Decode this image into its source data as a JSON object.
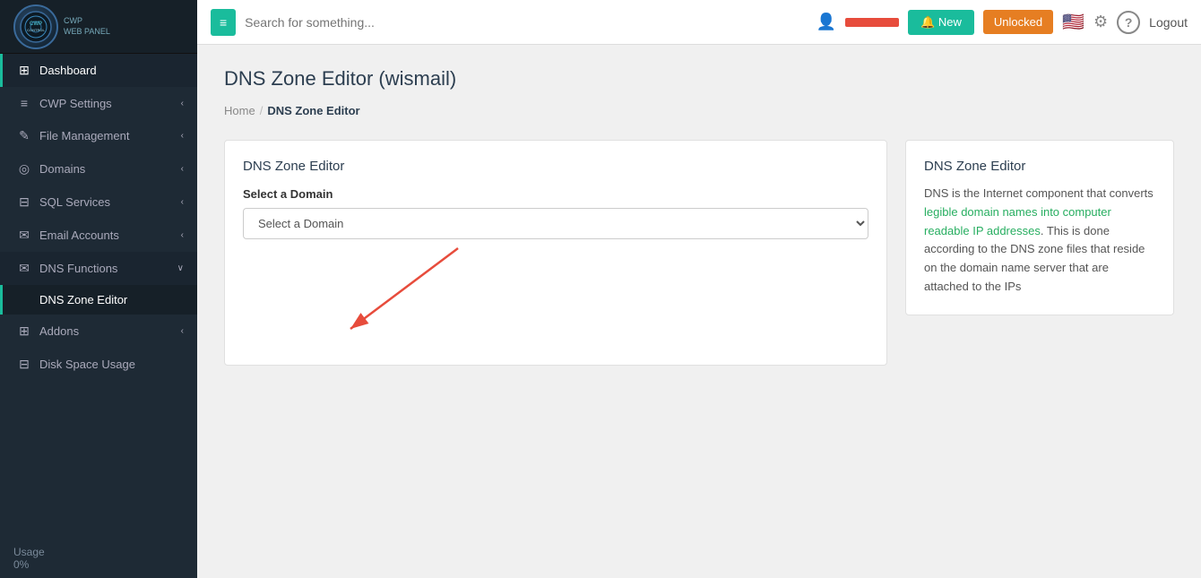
{
  "sidebar": {
    "logo": {
      "text": "CWP",
      "subtext": "CONTROL\nWEB PANEL"
    },
    "items": [
      {
        "id": "dashboard",
        "label": "Dashboard",
        "icon": "⊞",
        "active": true,
        "hasArrow": false
      },
      {
        "id": "cwp-settings",
        "label": "CWP Settings",
        "icon": "≡",
        "active": false,
        "hasArrow": true
      },
      {
        "id": "file-management",
        "label": "File Management",
        "icon": "✎",
        "active": false,
        "hasArrow": true
      },
      {
        "id": "domains",
        "label": "Domains",
        "icon": "◎",
        "active": false,
        "hasArrow": true
      },
      {
        "id": "sql-services",
        "label": "SQL Services",
        "icon": "⊟",
        "active": false,
        "hasArrow": true
      },
      {
        "id": "email-accounts",
        "label": "Email Accounts",
        "icon": "✉",
        "active": false,
        "hasArrow": true
      },
      {
        "id": "dns-functions",
        "label": "DNS Functions",
        "icon": "✉",
        "active": true,
        "hasArrow": true,
        "expanded": true
      },
      {
        "id": "addons",
        "label": "Addons",
        "icon": "⊞",
        "active": false,
        "hasArrow": true
      },
      {
        "id": "disk-space-usage",
        "label": "Disk Space Usage",
        "icon": "⊟",
        "active": false,
        "hasArrow": false
      }
    ],
    "subitems": {
      "dns-functions": [
        {
          "id": "dns-zone-editor",
          "label": "DNS Zone Editor",
          "active": true
        }
      ]
    },
    "footer": {
      "usage_label": "Usage",
      "usage_value": "0%"
    }
  },
  "topbar": {
    "menu_icon": "≡",
    "search_placeholder": "Search for something...",
    "new_label": "🔔 New",
    "unlocked_label": "Unlocked",
    "logout_label": "Logout",
    "help_label": "?"
  },
  "page": {
    "title": "DNS Zone Editor (wismail)",
    "breadcrumb_home": "Home",
    "breadcrumb_sep": "/",
    "breadcrumb_current": "DNS Zone Editor"
  },
  "main_card": {
    "title": "DNS Zone Editor",
    "form_label": "Select a Domain",
    "select_placeholder": "Select a Domain",
    "select_options": [
      "Select a Domain"
    ]
  },
  "side_card": {
    "title": "DNS Zone Editor",
    "text_part1": "DNS is the Internet component that converts ",
    "text_link": "legible domain names into computer readable IP addresses",
    "text_part2": ". This is done according to the DNS zone files that reside on the domain name server that are attached to the IPs"
  }
}
